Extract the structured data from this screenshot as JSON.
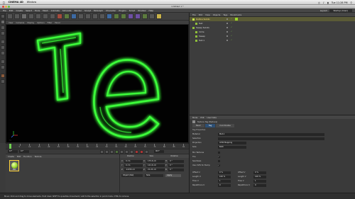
{
  "mac_menu": {
    "app": "CINEMA 4D",
    "items": [
      "Window"
    ],
    "clock": "Tue 11:28 PM"
  },
  "window_title": "Untitled 1 *",
  "c4d_menu": {
    "items": [
      "File",
      "Edit",
      "Create",
      "Select",
      "Tools",
      "Mesh",
      "Animate",
      "Simulate",
      "Render",
      "Sculpt",
      "MoGraph",
      "Character",
      "Plugins",
      "Script",
      "Window",
      "Help"
    ],
    "layout_label": "Layout:",
    "layout_value": "Startup (User)"
  },
  "viewport": {
    "menu": [
      "View",
      "Cameras",
      "Display",
      "Options",
      "Filter",
      "Panel"
    ],
    "letters": "Te"
  },
  "timeline": {
    "ticks": [
      "0",
      "5",
      "10",
      "15",
      "20",
      "25",
      "30",
      "35",
      "40",
      "45",
      "50",
      "55",
      "60",
      "65",
      "70",
      "75",
      "80",
      "85",
      "90"
    ],
    "start_frame": "0 F",
    "current_frame": "0 F",
    "end_frame": "90 F"
  },
  "material_panel": {
    "menu": [
      "Create",
      "Edit",
      "Function",
      "Texture"
    ],
    "mat_name": "Mat"
  },
  "coordinates": {
    "headers": [
      "Position",
      "Size",
      "Rotation"
    ],
    "rows": [
      {
        "axis": "X",
        "pos": "0 cm",
        "size": "175.6 cm",
        "rot_axis": "H",
        "rot": "0 °"
      },
      {
        "axis": "Y",
        "pos": "0 cm",
        "size": "121.6 cm",
        "rot_axis": "P",
        "rot": "0 °"
      },
      {
        "axis": "Z",
        "pos": "-4.636 cm",
        "size": "21.24 cm",
        "rot_axis": "B",
        "rot": "0 °"
      }
    ],
    "mode": "Object (Rel)",
    "size_mode": "Size",
    "apply": "Apply"
  },
  "objects": {
    "tabs": [
      "File",
      "Edit",
      "View",
      "Objects",
      "Tags",
      "Bookmarks"
    ],
    "rows": [
      {
        "name": "Outline Subdiv",
        "selected": true,
        "indent": 0
      },
      {
        "name": "Text",
        "selected": false,
        "indent": 1
      },
      {
        "name": "Sweep Subdiv",
        "selected": false,
        "indent": 0
      },
      {
        "name": "Circle",
        "selected": false,
        "indent": 1
      },
      {
        "name": "Sweep",
        "selected": false,
        "indent": 1
      },
      {
        "name": "Text.1",
        "selected": false,
        "indent": 1
      }
    ]
  },
  "attributes": {
    "menu": [
      "Mode",
      "Edit",
      "User Data"
    ],
    "title": "Texture Tag [Texture]",
    "tabs": [
      "Basic",
      "Tag",
      "Coordinates"
    ],
    "section": "Tag Properties",
    "material_label": "Material",
    "material_value": "Mat.1",
    "selection_label": "Selection",
    "projection_label": "Projection",
    "projection_value": "UVW Mapping",
    "side_label": "Side",
    "side_value": "Both",
    "mix_label": "Mix Textures",
    "tile_label": "Tile",
    "seamless_label": "Seamless",
    "use_uvw_label": "Use UVW for Bump",
    "offset_u_label": "Offset U",
    "offset_u": "0 %",
    "offset_v_label": "Offset V",
    "offset_v": "0 %",
    "length_u_label": "Length U",
    "length_u": "100 %",
    "length_v_label": "Length V",
    "length_v": "100 %",
    "tiles_u_label": "Tiles U",
    "tiles_u": "1",
    "tiles_v_label": "Tiles V",
    "tiles_v": "1",
    "rep_u_label": "Repetitions U",
    "rep_u": "0",
    "rep_v_label": "Repetitions V",
    "rep_v": "0"
  },
  "status": "Move: Click and drag to move elements. Hold down SHIFT to quantize movement / add to the selection in point mode, CTRL to remove.",
  "colors": {
    "neon": "#3cff3a",
    "selected_row": "#5b5b36",
    "active_tab": "#2d4f74"
  }
}
